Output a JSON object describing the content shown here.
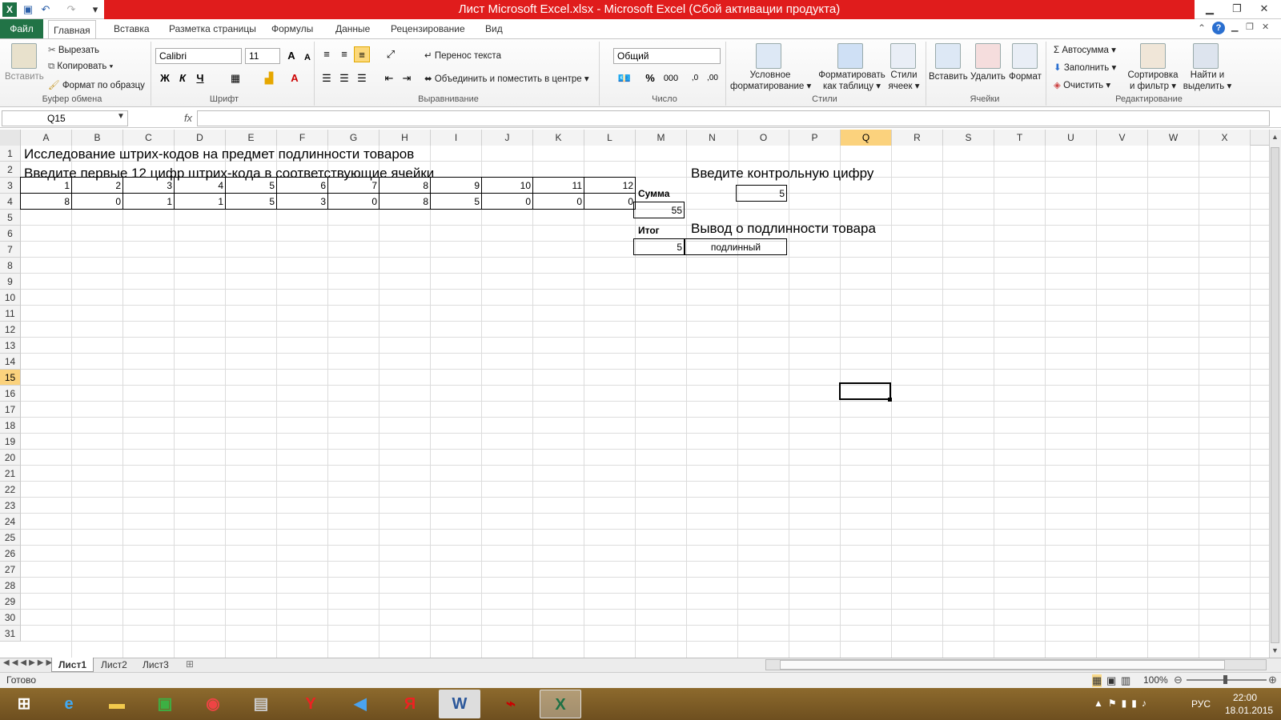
{
  "window": {
    "title": "Лист Microsoft Excel.xlsx  -  Microsoft Excel (Сбой активации продукта)"
  },
  "tabs": [
    "Файл",
    "Главная",
    "Вставка",
    "Разметка страницы",
    "Формулы",
    "Данные",
    "Рецензирование",
    "Вид"
  ],
  "ribbon": {
    "clipboard": {
      "label": "Буфер обмена",
      "paste": "Вставить",
      "cut": "Вырезать",
      "copy": "Копировать",
      "format_painter": "Формат по образцу"
    },
    "font": {
      "label": "Шрифт",
      "name": "Calibri",
      "size": "11",
      "bold": "Ж",
      "italic": "К",
      "underline": "Ч"
    },
    "alignment": {
      "label": "Выравнивание",
      "wrap": "Перенос текста",
      "merge": "Объединить и поместить в центре"
    },
    "number": {
      "label": "Число",
      "format": "Общий",
      "percent": "%",
      "thousands": "000"
    },
    "styles": {
      "label": "Стили",
      "conditional1": "Условное",
      "conditional2": "форматирование",
      "table1": "Форматировать",
      "table2": "как таблицу",
      "cell1": "Стили",
      "cell2": "ячеек"
    },
    "cells": {
      "label": "Ячейки",
      "insert": "Вставить",
      "delete": "Удалить",
      "format": "Формат"
    },
    "editing": {
      "label": "Редактирование",
      "autosum": "Автосумма",
      "fill": "Заполнить",
      "clear": "Очистить",
      "sort1": "Сортировка",
      "sort2": "и фильтр",
      "find1": "Найти и",
      "find2": "выделить"
    }
  },
  "formula_bar": {
    "name_box": "Q15",
    "fx": "fx",
    "value": ""
  },
  "columns": [
    "A",
    "B",
    "C",
    "D",
    "E",
    "F",
    "G",
    "H",
    "I",
    "J",
    "K",
    "L",
    "M",
    "N",
    "O",
    "P",
    "Q",
    "R",
    "S",
    "T",
    "U",
    "V",
    "W",
    "X"
  ],
  "selected_column": "Q",
  "selected_row": 15,
  "rows": 31,
  "sheet": {
    "r1": "Исследование штрих-кодов на предмет подлинности товаров",
    "r2": "Введите первые 12 цифр штрих-кода в соответствующие ячейки",
    "control_label": "Введите контрольную цифру",
    "row3": [
      "1",
      "2",
      "3",
      "4",
      "5",
      "6",
      "7",
      "8",
      "9",
      "10",
      "11",
      "12"
    ],
    "sum_label": "Сумма",
    "control_value": "5",
    "row4": [
      "8",
      "0",
      "1",
      "1",
      "5",
      "3",
      "0",
      "8",
      "5",
      "0",
      "0",
      "0"
    ],
    "sum_value": "55",
    "result_label": "Итог",
    "conclusion_label": "Вывод о подлинности товара",
    "result_value": "5",
    "conclusion_value": "подлинный"
  },
  "sheet_tabs": [
    "Лист1",
    "Лист2",
    "Лист3"
  ],
  "status": {
    "ready": "Готово",
    "zoom": "100%"
  },
  "taskbar": {
    "lang": "РУС",
    "time": "22:00",
    "date": "18.01.2015"
  }
}
